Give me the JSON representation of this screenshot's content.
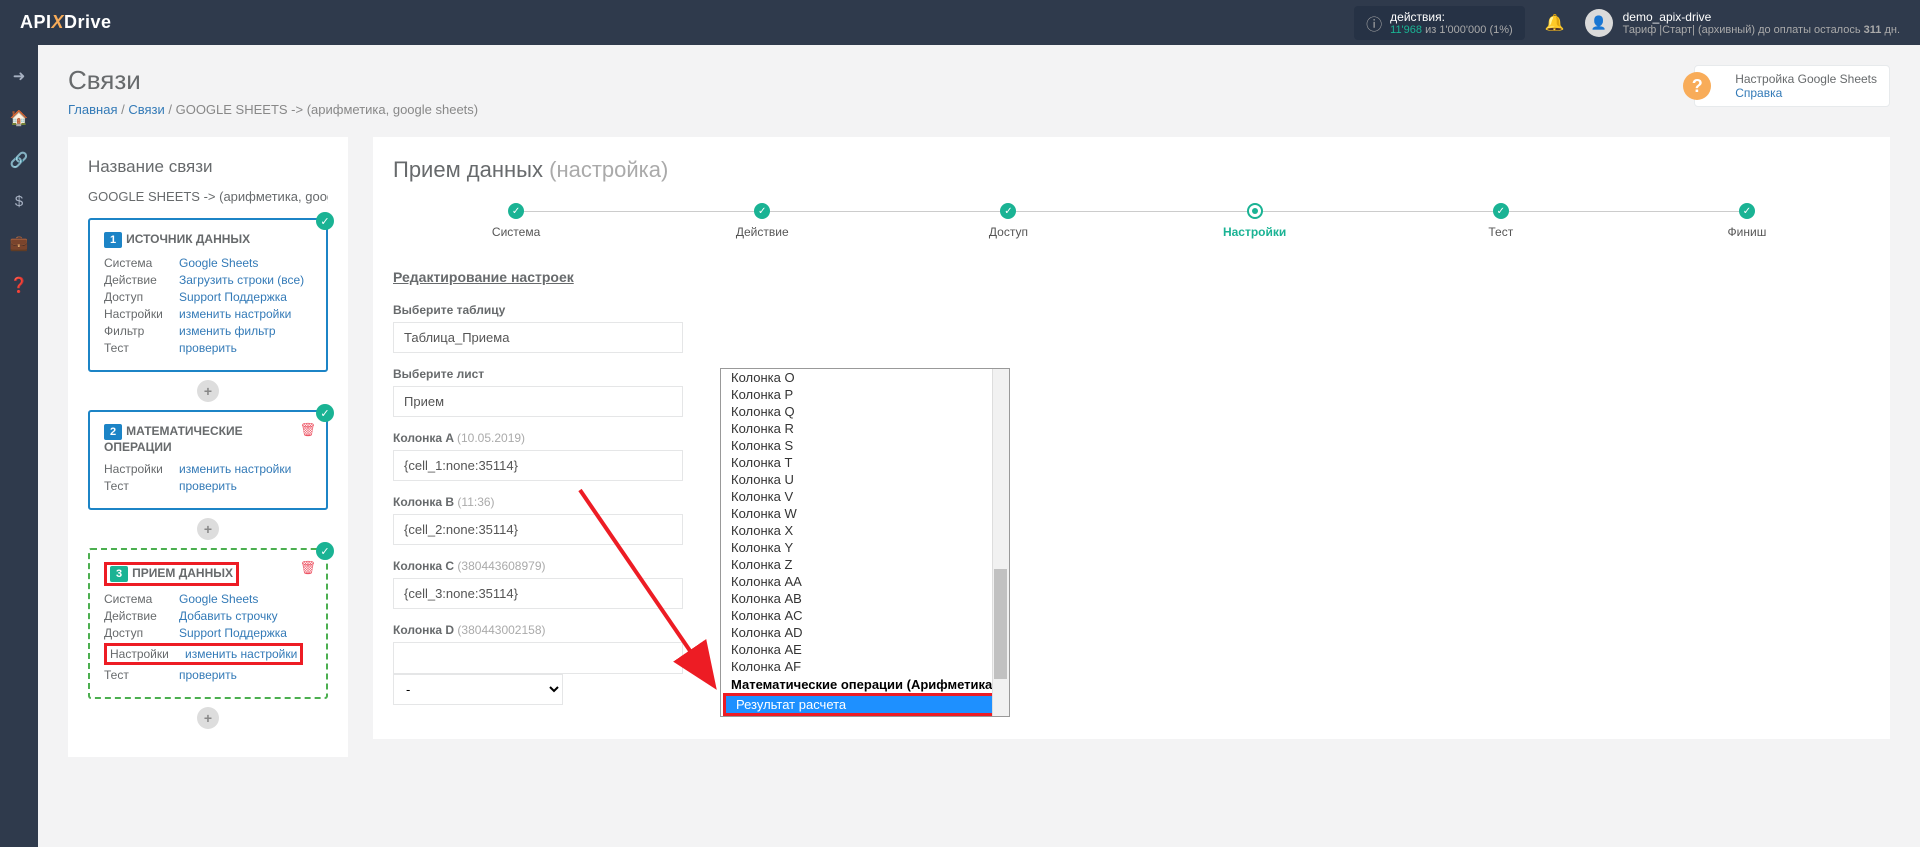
{
  "logo": {
    "part1": "API",
    "part2": "X",
    "part3": "Drive"
  },
  "actions": {
    "label": "действия:",
    "used": "11'968",
    "of": "из",
    "total": "1'000'000",
    "pct": "(1%)"
  },
  "user": {
    "name": "demo_apix-drive",
    "tariff1": "Тариф |Старт| (архивный) до оплаты осталось ",
    "days": "311",
    "tariff2": " дн."
  },
  "page": {
    "title": "Связи"
  },
  "breadcrumb": {
    "home": "Главная",
    "links": "Связи",
    "current": "GOOGLE SHEETS -> (арифметика, google sheets)"
  },
  "help": {
    "title": "Настройка Google Sheets",
    "link": "Справка"
  },
  "sidebar": {
    "title": "Название связи",
    "name": "GOOGLE SHEETS -> (арифметика, google sheets",
    "card1": {
      "num": "1",
      "title": "ИСТОЧНИК ДАННЫХ",
      "rows": [
        {
          "label": "Система",
          "value": "Google Sheets"
        },
        {
          "label": "Действие",
          "value": "Загрузить строки (все)"
        },
        {
          "label": "Доступ",
          "value": "Support Поддержка"
        },
        {
          "label": "Настройки",
          "value": "изменить настройки"
        },
        {
          "label": "Фильтр",
          "value": "изменить фильтр"
        },
        {
          "label": "Тест",
          "value": "проверить"
        }
      ]
    },
    "card2": {
      "num": "2",
      "title": "МАТЕМАТИЧЕСКИЕ ОПЕРАЦИИ",
      "rows": [
        {
          "label": "Настройки",
          "value": "изменить настройки"
        },
        {
          "label": "Тест",
          "value": "проверить"
        }
      ]
    },
    "card3": {
      "num": "3",
      "title": "ПРИЕМ ДАННЫХ",
      "rows": [
        {
          "label": "Система",
          "value": "Google Sheets"
        },
        {
          "label": "Действие",
          "value": "Добавить строчку"
        },
        {
          "label": "Доступ",
          "value": "Support Поддержка"
        },
        {
          "label": "Настройки",
          "value": "изменить настройки"
        },
        {
          "label": "Тест",
          "value": "проверить"
        }
      ]
    }
  },
  "main": {
    "title": "Прием данных",
    "subtitle": "(настройка)",
    "steps": [
      "Система",
      "Действие",
      "Доступ",
      "Настройки",
      "Тест",
      "Финиш"
    ],
    "section": "Редактирование настроек",
    "fields": {
      "table": {
        "label": "Выберите таблицу",
        "value": "Таблица_Приема"
      },
      "sheet": {
        "label": "Выберите лист",
        "value": "Прием"
      },
      "colA": {
        "label": "Колонка A",
        "hint": "(10.05.2019)",
        "value": "{cell_1:none:35114}"
      },
      "colB": {
        "label": "Колонка B",
        "hint": "(11:36)",
        "value": "{cell_2:none:35114}"
      },
      "colC": {
        "label": "Колонка C",
        "hint": "(380443608979)",
        "value": "{cell_3:none:35114}"
      },
      "colD": {
        "label": "Колонка D",
        "hint": "(380443002158)",
        "value": ""
      },
      "selectDash": "-"
    }
  },
  "dropdown": {
    "items": [
      "Колонка O",
      "Колонка P",
      "Колонка Q",
      "Колонка R",
      "Колонка S",
      "Колонка T",
      "Колонка U",
      "Колонка V",
      "Колонка W",
      "Колонка X",
      "Колонка Y",
      "Колонка Z",
      "Колонка AA",
      "Колонка AB",
      "Колонка AC",
      "Колонка AD",
      "Колонка AE",
      "Колонка AF"
    ],
    "group": "Математические операции (Арифметика)",
    "selected": "Результат расчета"
  }
}
